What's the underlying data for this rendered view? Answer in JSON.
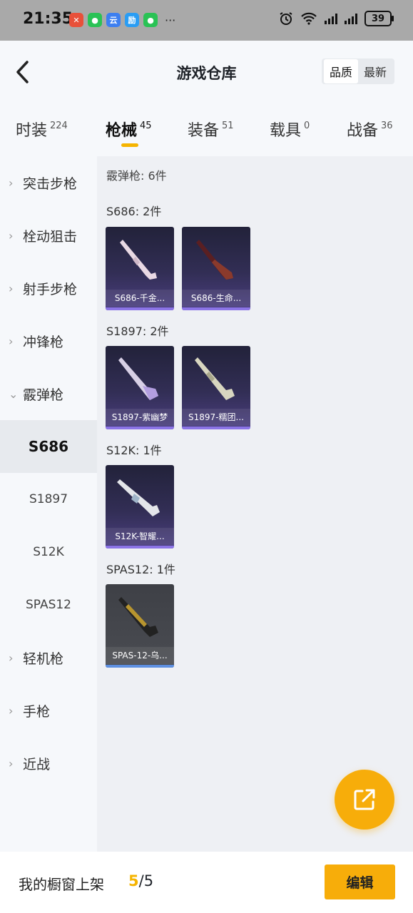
{
  "status_bar": {
    "time": "21:35",
    "dots": "···",
    "battery": "39",
    "apps": [
      {
        "name": "app-red",
        "color": "#e8503a",
        "glyph": "✕"
      },
      {
        "name": "wechat",
        "color": "#2ac255",
        "glyph": "●"
      },
      {
        "name": "app-blue",
        "color": "#3d7ff0",
        "glyph": "云"
      },
      {
        "name": "app-blue2",
        "color": "#2a9df4",
        "glyph": "励"
      },
      {
        "name": "wechat2",
        "color": "#2ac255",
        "glyph": "●"
      }
    ]
  },
  "header": {
    "title": "游戏仓库",
    "sort_options": [
      "品质",
      "最新"
    ]
  },
  "tabs": [
    {
      "label": "时装",
      "count": "224"
    },
    {
      "label": "枪械",
      "count": "45",
      "active": true
    },
    {
      "label": "装备",
      "count": "51"
    },
    {
      "label": "载具",
      "count": "0"
    },
    {
      "label": "战备",
      "count": "36"
    }
  ],
  "sidebar": {
    "categories": [
      "突击步枪",
      "栓动狙击",
      "射手步枪",
      "冲锋枪",
      "霰弹枪",
      "轻机枪",
      "手枪",
      "近战"
    ],
    "expanded": "霰弹枪",
    "subitems": [
      "S686",
      "S1897",
      "S12K",
      "SPAS12"
    ],
    "active_sub": "S686"
  },
  "content": {
    "heading": "霰弹枪: 6件",
    "groups": [
      {
        "title": "S686: 2件",
        "items": [
          "S686-千金...",
          "S686-生命..."
        ]
      },
      {
        "title": "S1897: 2件",
        "items": [
          "S1897-紫幽梦",
          "S1897-糯团..."
        ]
      },
      {
        "title": "S12K: 1件",
        "items": [
          "S12K-智耀..."
        ]
      },
      {
        "title": "SPAS12: 1件",
        "items": [
          "SPAS-12-乌..."
        ]
      }
    ]
  },
  "colors": {
    "accent": "#f7ad0a",
    "card_purple": "#322e55",
    "card_grey": "#4a4c52"
  },
  "bottom": {
    "label": "我的橱窗上架",
    "current": "5",
    "total": "/5",
    "edit": "编辑"
  }
}
